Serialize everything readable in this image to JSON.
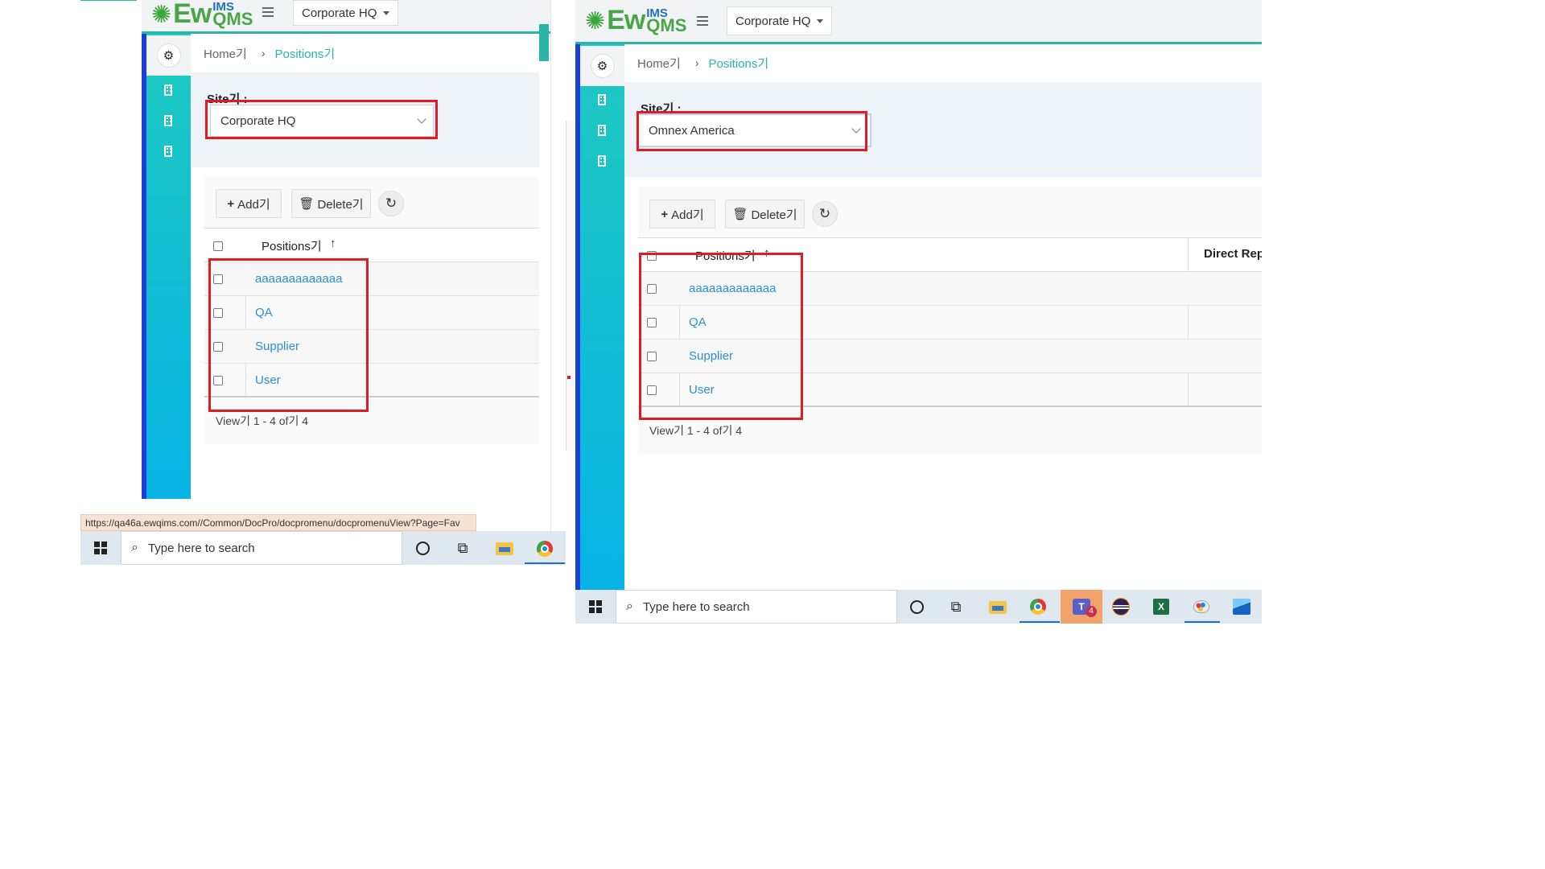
{
  "app": {
    "logo_main": "Ew",
    "logo_sup": "IMS",
    "logo_sub": "QMS"
  },
  "left": {
    "header_site": "Corporate HQ",
    "breadcrumb": {
      "home": "Home기",
      "current": "Positions기"
    },
    "site_label": "Site기 :",
    "site_value": "Corporate HQ",
    "toolbar": {
      "add": "Add기",
      "delete": "Delete기"
    },
    "grid": {
      "column": "Positions기",
      "rows": [
        "aaaaaaaaaaaaa",
        "QA",
        "Supplier",
        "User"
      ]
    },
    "pager": "View기 1 - 4 of기 4",
    "status_url": "https://qa46a.ewqims.com//Common/DocPro/docpromenu/docpromenuView?Page=Fav",
    "taskbar_search": "Type here to search"
  },
  "right": {
    "header_site": "Corporate HQ",
    "breadcrumb": {
      "home": "Home기",
      "current": "Positions기"
    },
    "site_label": "Site기 :",
    "site_value": "Omnex America",
    "toolbar": {
      "add": "Add기",
      "delete": "Delete기"
    },
    "grid": {
      "column": "Positions기",
      "column2": "Direct Rep",
      "rows": [
        "aaaaaaaaaaaaa",
        "QA",
        "Supplier",
        "User"
      ]
    },
    "pager": "View기 1 - 4 of기 4",
    "taskbar_search": "Type here to search",
    "teams_badge": "4"
  },
  "colors": {
    "accent": "#2bb5a6",
    "link": "#2a8fd6",
    "highlight": "#e01b24",
    "sidebar_top": "#1ec9c0",
    "sidebar_bottom": "#08b3e6"
  }
}
